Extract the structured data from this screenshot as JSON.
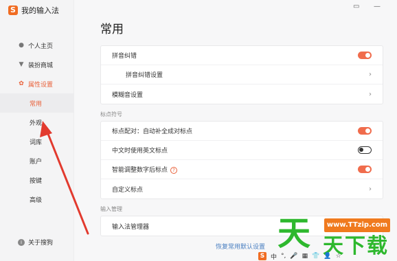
{
  "app": {
    "logo_letter": "S",
    "title": "我的输入法"
  },
  "sidebar": {
    "items": [
      {
        "label": "个人主页",
        "icon": "person-icon"
      },
      {
        "label": "装扮商城",
        "icon": "shirt-icon"
      },
      {
        "label": "属性设置",
        "icon": "settings-icon"
      }
    ],
    "sub_items": [
      "常用",
      "外观",
      "词库",
      "账户",
      "按键",
      "高级"
    ],
    "selected_sub": "常用",
    "about": "关于搜狗"
  },
  "main": {
    "title": "常用",
    "group1": [
      {
        "label": "拼音纠错",
        "control": "toggle-on"
      },
      {
        "label": "拼音纠错设置",
        "control": "chevron"
      },
      {
        "label": "模糊音设置",
        "control": "chevron"
      }
    ],
    "section2_label": "标点符号",
    "group2": [
      {
        "label": "标点配对：自动补全成对标点",
        "control": "toggle-on"
      },
      {
        "label": "中文时使用英文标点",
        "control": "toggle-off"
      },
      {
        "label": "智能调整数字后标点",
        "control": "toggle-on",
        "help": "?"
      },
      {
        "label": "自定义标点",
        "control": "chevron"
      }
    ],
    "section3_label": "输入管理",
    "group3": [
      {
        "label": "输入法管理器"
      }
    ],
    "restore_link": "恢复常用默认设置"
  },
  "watermark": {
    "url": "www.TTzip.com",
    "big": "天",
    "small": "天下载"
  },
  "taskbar": {
    "logo": "S",
    "items": [
      "中",
      "°,",
      "🎤",
      "▦",
      "👕",
      "👤",
      "☆"
    ]
  },
  "colors": {
    "accent": "#e9613a",
    "toggle_on": "#f06c4c",
    "link": "#4a7fc1",
    "watermark_green": "#2eb82e",
    "watermark_orange": "#f07a1e"
  }
}
